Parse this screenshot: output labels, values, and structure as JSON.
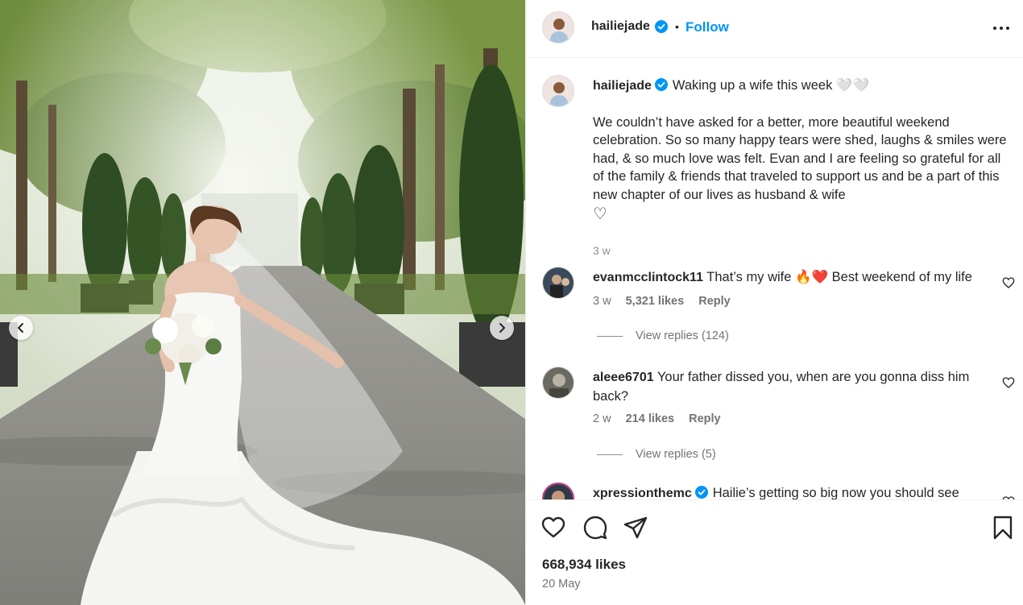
{
  "post": {
    "username": "hailiejade",
    "separator": "•",
    "follow_label": "Follow",
    "caption_title": "Waking up a wife this week 🤍🤍",
    "caption_body": "We couldn’t have asked for a better, more beautiful weekend celebration. So so many happy tears were shed, laughs & smiles were had, & so much love was felt. Evan and I are feeling so grateful for all of the family & friends that traveled to support us and be a part of this new chapter of our lives as husband & wife",
    "caption_emoji": "♡",
    "caption_time": "3 w",
    "likes": "668,934 likes",
    "date": "20 May"
  },
  "comments": [
    {
      "username": "evanmcclintock11",
      "text": "That’s my wife 🔥❤️ Best weekend of my life",
      "time": "3 w",
      "likes": "5,321 likes",
      "reply": "Reply",
      "view_replies": "View replies (124)"
    },
    {
      "username": "aleee6701",
      "text": "Your father dissed you, when are you gonna diss him back?",
      "time": "2 w",
      "likes": "214 likes",
      "reply": "Reply",
      "view_replies": "View replies (5)"
    },
    {
      "username": "xpressionthemc",
      "text": "Hailie’s getting so big now you should see"
    }
  ],
  "colors": {
    "accent": "#0095f6",
    "verified": "#0095f6",
    "text": "#262626",
    "muted": "#737373",
    "divider": "#efefef"
  },
  "icons": {
    "prev": "chevron-left-icon",
    "next": "chevron-right-icon",
    "more": "more-horizontal-icon",
    "like": "heart-outline-icon",
    "comment": "comment-bubble-icon",
    "share": "paper-plane-icon",
    "save": "bookmark-icon"
  }
}
